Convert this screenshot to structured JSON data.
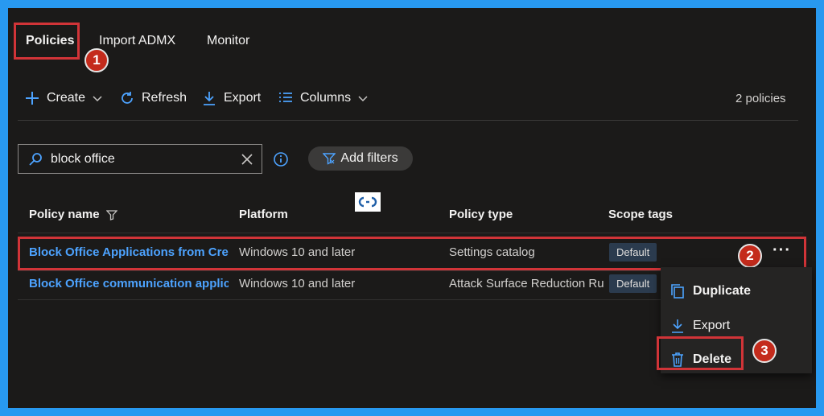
{
  "tabs": [
    {
      "label": "Policies",
      "active": true
    },
    {
      "label": "Import ADMX",
      "active": false
    },
    {
      "label": "Monitor",
      "active": false
    }
  ],
  "toolbar": {
    "create_label": "Create",
    "refresh_label": "Refresh",
    "export_label": "Export",
    "columns_label": "Columns",
    "count_text": "2 policies"
  },
  "search": {
    "value": "block office"
  },
  "filters": {
    "add_label": "Add filters"
  },
  "table": {
    "headers": {
      "policy_name": "Policy name",
      "platform": "Platform",
      "policy_type": "Policy type",
      "scope_tags": "Scope tags"
    },
    "rows": [
      {
        "policy_name": "Block Office Applications from Crea",
        "platform": "Windows 10 and later",
        "policy_type": "Settings catalog",
        "scope_tag": "Default"
      },
      {
        "policy_name": "Block Office communication applica",
        "platform": "Windows 10 and later",
        "policy_type": "Attack Surface Reduction Ru",
        "scope_tag": "Default"
      }
    ],
    "more_label": "···"
  },
  "context_menu": {
    "duplicate_label": "Duplicate",
    "export_label": "Export",
    "delete_label": "Delete"
  },
  "annotations": {
    "step1": "1",
    "step2": "2",
    "step3": "3"
  },
  "colors": {
    "accent": "#4da3ff",
    "highlight": "#d13438",
    "frame": "#2899f0"
  }
}
